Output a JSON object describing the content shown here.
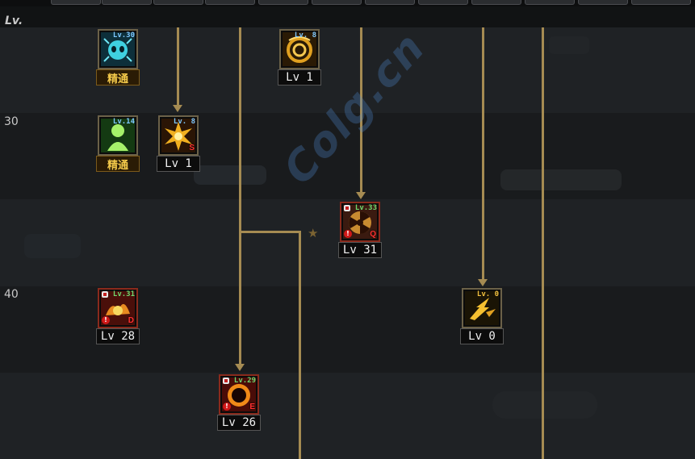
{
  "header": {
    "level_label": "Lv."
  },
  "tree": {
    "level_markers": [
      "30",
      "40"
    ],
    "skills": [
      {
        "badge": "Lv.30",
        "caption": "精通",
        "badge_color": "#7ec8ff"
      },
      {
        "badge": "Lv. 8",
        "caption": "Lv 1",
        "badge_color": "#7ec8ff"
      },
      {
        "badge": "Lv.14",
        "caption": "精通",
        "badge_color": "#7ec8ff"
      },
      {
        "badge": "Lv. 8",
        "caption": "Lv 1",
        "badge_color": "#7ec8ff",
        "key": "S"
      },
      {
        "badge": "Lv.33",
        "caption": "Lv 31",
        "badge_color": "#6fd86f",
        "key": "Q",
        "locked": true
      },
      {
        "badge": "Lv.31",
        "caption": "Lv 28",
        "badge_color": "#6fd86f",
        "key": "D",
        "locked": true
      },
      {
        "badge": "Lv. 0",
        "caption": "Lv 0",
        "badge_color": "#f0c040"
      },
      {
        "badge": "Lv.29",
        "caption": "Lv 26",
        "badge_color": "#6fd86f",
        "key": "E",
        "locked": true
      }
    ]
  },
  "watermark": {
    "text": "Colg.cn"
  },
  "colors": {
    "connector": "#a58b52",
    "background": "#17191b"
  }
}
